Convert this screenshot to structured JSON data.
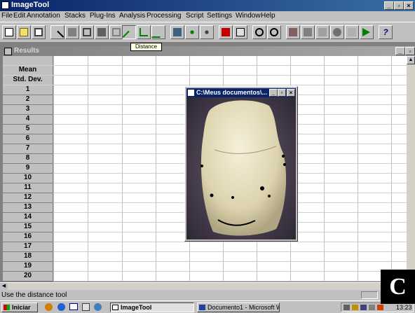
{
  "app": {
    "title": "ImageTool"
  },
  "menu": [
    "File",
    "Edit",
    "Annotation",
    "Stacks",
    "Plug-Ins",
    "Analysis",
    "Processing",
    "Script",
    "Settings",
    "Window",
    "Help"
  ],
  "toolbar": {
    "tooltip": "Distance"
  },
  "results": {
    "title": "Results",
    "stat_rows": [
      "Mean",
      "Std. Dev."
    ],
    "row_numbers": [
      "1",
      "2",
      "3",
      "4",
      "5",
      "6",
      "7",
      "8",
      "9",
      "10",
      "11",
      "12",
      "13",
      "14",
      "15",
      "16",
      "17",
      "18",
      "19",
      "20"
    ]
  },
  "image_window": {
    "title": "C:\\Meus documentos\\..."
  },
  "statusbar": {
    "text": "Use the distance tool"
  },
  "taskbar": {
    "start_label": "Iniciar",
    "tasks": [
      "ImageTool",
      "Documento1 - Microsoft W..."
    ],
    "clock": "13:23"
  },
  "figure_label": "C",
  "colors": {
    "title_active": "#0a246a",
    "title_inactive": "#808080",
    "face": "#c0c0c0"
  }
}
